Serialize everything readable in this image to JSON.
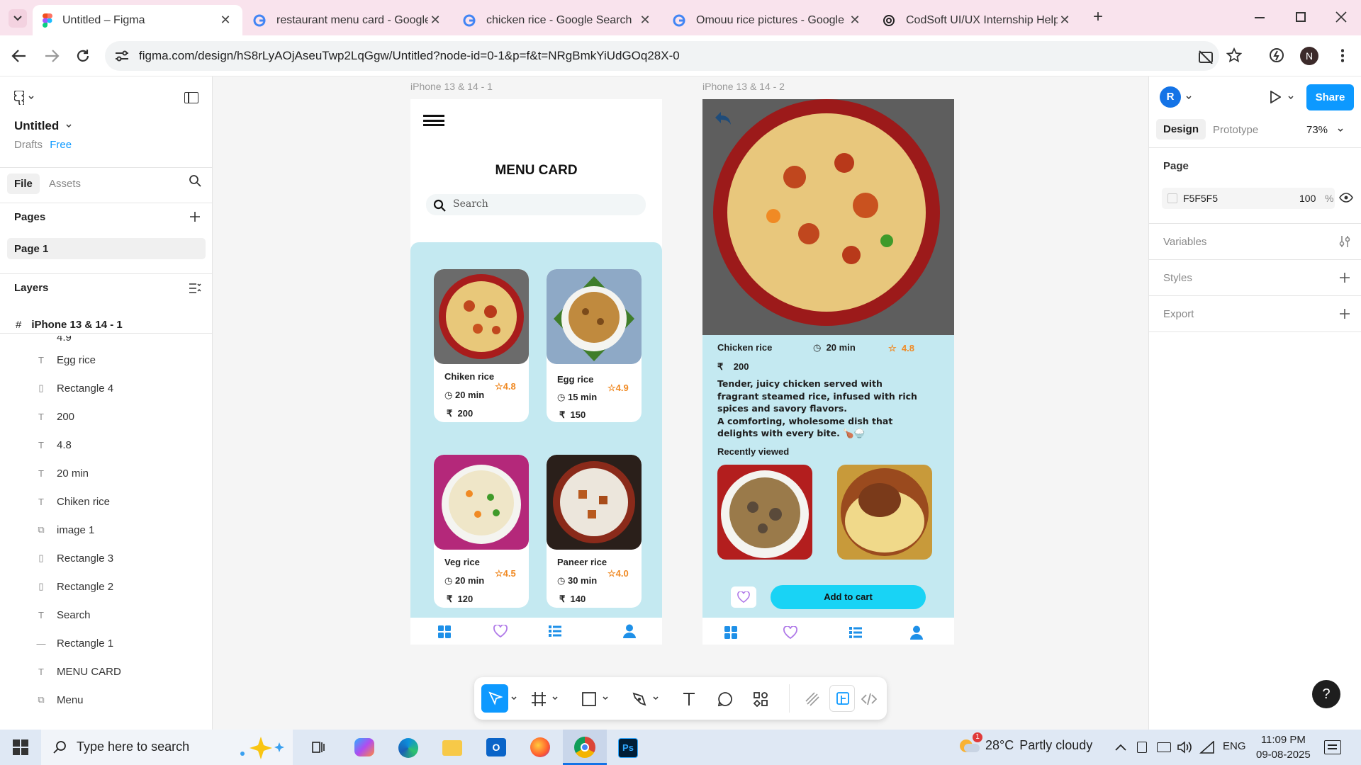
{
  "browser": {
    "tabs": [
      {
        "title": "Untitled – Figma",
        "close": "✕"
      },
      {
        "title": "restaurant menu card - Google",
        "close": "✕"
      },
      {
        "title": "chicken rice - Google Search",
        "close": "✕"
      },
      {
        "title": "Omouu rice pictures - Google S",
        "close": "✕"
      },
      {
        "title": "CodSoft UI/UX Internship Help",
        "close": "✕"
      }
    ],
    "new_tab": "+",
    "url": "figma.com/design/hS8rLyAOjAseuTwp2LqGgw/Untitled?node-id=0-1&p=f&t=NRgBmkYiUdGOq28X-0",
    "profile_initial": "N"
  },
  "left_panel": {
    "file_name": "Untitled",
    "drafts": "Drafts",
    "plan": "Free",
    "tab_file": "File",
    "tab_assets": "Assets",
    "pages_title": "Pages",
    "page_item": "Page 1",
    "layers_title": "Layers",
    "frame_name": "iPhone 13 & 14 - 1",
    "cut_item": "4.9",
    "layers": [
      {
        "name": "Egg rice",
        "type": "text"
      },
      {
        "name": "Rectangle 4",
        "type": "rect"
      },
      {
        "name": "200",
        "type": "text"
      },
      {
        "name": "4.8",
        "type": "text"
      },
      {
        "name": "20 min",
        "type": "text"
      },
      {
        "name": "Chiken rice",
        "type": "text"
      },
      {
        "name": "image 1",
        "type": "image"
      },
      {
        "name": "Rectangle 3",
        "type": "rect"
      },
      {
        "name": "Rectangle 2",
        "type": "rect"
      },
      {
        "name": "Search",
        "type": "text"
      },
      {
        "name": "Rectangle 1",
        "type": "line"
      },
      {
        "name": "MENU CARD",
        "type": "text"
      },
      {
        "name": "Menu",
        "type": "image"
      }
    ]
  },
  "canvas": {
    "frame1_label": "iPhone 13 & 14 - 1",
    "frame2_label": "iPhone 13 & 14 - 2",
    "menu_title": "MENU CARD",
    "search_placeholder": "Search",
    "currency": "₹",
    "items": [
      {
        "name": "Chiken rice",
        "time": "20 min",
        "rating": "4.8",
        "price": "200"
      },
      {
        "name": "Egg rice",
        "time": "15 min",
        "rating": "4.9",
        "price": "150"
      },
      {
        "name": "Veg rice",
        "time": "20 min",
        "rating": "4.5",
        "price": "120"
      },
      {
        "name": "Paneer rice",
        "time": "30 min",
        "rating": "4.0",
        "price": "140"
      }
    ],
    "detail": {
      "name": "Chicken rice",
      "time": "20 min",
      "rating": "4.8",
      "price": "200",
      "desc1": "Tender, juicy chicken served with fragrant steamed rice, infused with rich spices and savory flavors.",
      "desc2": " A comforting, wholesome dish that delights with every bite. 🍗🍚",
      "recent": "Recently viewed",
      "cta": "Add to cart"
    }
  },
  "toolbar": {
    "tools": [
      "move",
      "frame",
      "rectangle",
      "pen",
      "text",
      "comment",
      "components",
      "draw",
      "dev-mode",
      "code"
    ]
  },
  "right_panel": {
    "avatar": "R",
    "share": "Share",
    "tab_design": "Design",
    "tab_prototype": "Prototype",
    "zoom": "73%",
    "page_title": "Page",
    "bg_hex": "F5F5F5",
    "bg_opacity": "100",
    "pct": "%",
    "variables": "Variables",
    "styles": "Styles",
    "export": "Export",
    "help": "?"
  },
  "taskbar": {
    "search_placeholder": "Type here to search",
    "weather_temp": "28°C",
    "weather_text": "Partly cloudy",
    "weather_badge": "1",
    "lang": "ENG",
    "time": "11:09 PM",
    "date": "09-08-2025"
  },
  "colors": {
    "accent": "#0d99ff",
    "teal_bg": "#c4e9f1",
    "cta": "#19d3f5",
    "rating": "#f08a24"
  }
}
